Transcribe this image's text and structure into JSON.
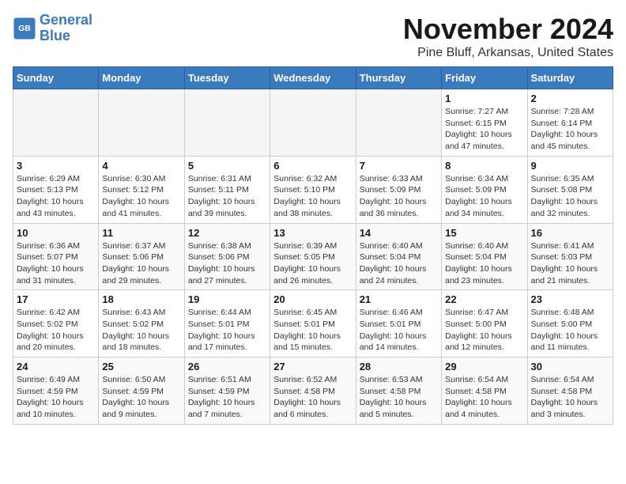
{
  "header": {
    "logo_line1": "General",
    "logo_line2": "Blue",
    "month": "November 2024",
    "location": "Pine Bluff, Arkansas, United States"
  },
  "days_of_week": [
    "Sunday",
    "Monday",
    "Tuesday",
    "Wednesday",
    "Thursday",
    "Friday",
    "Saturday"
  ],
  "weeks": [
    [
      {
        "day": "",
        "empty": true
      },
      {
        "day": "",
        "empty": true
      },
      {
        "day": "",
        "empty": true
      },
      {
        "day": "",
        "empty": true
      },
      {
        "day": "",
        "empty": true
      },
      {
        "day": "1",
        "info": "Sunrise: 7:27 AM\nSunset: 6:15 PM\nDaylight: 10 hours\nand 47 minutes."
      },
      {
        "day": "2",
        "info": "Sunrise: 7:28 AM\nSunset: 6:14 PM\nDaylight: 10 hours\nand 45 minutes."
      }
    ],
    [
      {
        "day": "3",
        "info": "Sunrise: 6:29 AM\nSunset: 5:13 PM\nDaylight: 10 hours\nand 43 minutes."
      },
      {
        "day": "4",
        "info": "Sunrise: 6:30 AM\nSunset: 5:12 PM\nDaylight: 10 hours\nand 41 minutes."
      },
      {
        "day": "5",
        "info": "Sunrise: 6:31 AM\nSunset: 5:11 PM\nDaylight: 10 hours\nand 39 minutes."
      },
      {
        "day": "6",
        "info": "Sunrise: 6:32 AM\nSunset: 5:10 PM\nDaylight: 10 hours\nand 38 minutes."
      },
      {
        "day": "7",
        "info": "Sunrise: 6:33 AM\nSunset: 5:09 PM\nDaylight: 10 hours\nand 36 minutes."
      },
      {
        "day": "8",
        "info": "Sunrise: 6:34 AM\nSunset: 5:09 PM\nDaylight: 10 hours\nand 34 minutes."
      },
      {
        "day": "9",
        "info": "Sunrise: 6:35 AM\nSunset: 5:08 PM\nDaylight: 10 hours\nand 32 minutes."
      }
    ],
    [
      {
        "day": "10",
        "info": "Sunrise: 6:36 AM\nSunset: 5:07 PM\nDaylight: 10 hours\nand 31 minutes."
      },
      {
        "day": "11",
        "info": "Sunrise: 6:37 AM\nSunset: 5:06 PM\nDaylight: 10 hours\nand 29 minutes."
      },
      {
        "day": "12",
        "info": "Sunrise: 6:38 AM\nSunset: 5:06 PM\nDaylight: 10 hours\nand 27 minutes."
      },
      {
        "day": "13",
        "info": "Sunrise: 6:39 AM\nSunset: 5:05 PM\nDaylight: 10 hours\nand 26 minutes."
      },
      {
        "day": "14",
        "info": "Sunrise: 6:40 AM\nSunset: 5:04 PM\nDaylight: 10 hours\nand 24 minutes."
      },
      {
        "day": "15",
        "info": "Sunrise: 6:40 AM\nSunset: 5:04 PM\nDaylight: 10 hours\nand 23 minutes."
      },
      {
        "day": "16",
        "info": "Sunrise: 6:41 AM\nSunset: 5:03 PM\nDaylight: 10 hours\nand 21 minutes."
      }
    ],
    [
      {
        "day": "17",
        "info": "Sunrise: 6:42 AM\nSunset: 5:02 PM\nDaylight: 10 hours\nand 20 minutes."
      },
      {
        "day": "18",
        "info": "Sunrise: 6:43 AM\nSunset: 5:02 PM\nDaylight: 10 hours\nand 18 minutes."
      },
      {
        "day": "19",
        "info": "Sunrise: 6:44 AM\nSunset: 5:01 PM\nDaylight: 10 hours\nand 17 minutes."
      },
      {
        "day": "20",
        "info": "Sunrise: 6:45 AM\nSunset: 5:01 PM\nDaylight: 10 hours\nand 15 minutes."
      },
      {
        "day": "21",
        "info": "Sunrise: 6:46 AM\nSunset: 5:01 PM\nDaylight: 10 hours\nand 14 minutes."
      },
      {
        "day": "22",
        "info": "Sunrise: 6:47 AM\nSunset: 5:00 PM\nDaylight: 10 hours\nand 12 minutes."
      },
      {
        "day": "23",
        "info": "Sunrise: 6:48 AM\nSunset: 5:00 PM\nDaylight: 10 hours\nand 11 minutes."
      }
    ],
    [
      {
        "day": "24",
        "info": "Sunrise: 6:49 AM\nSunset: 4:59 PM\nDaylight: 10 hours\nand 10 minutes."
      },
      {
        "day": "25",
        "info": "Sunrise: 6:50 AM\nSunset: 4:59 PM\nDaylight: 10 hours\nand 9 minutes."
      },
      {
        "day": "26",
        "info": "Sunrise: 6:51 AM\nSunset: 4:59 PM\nDaylight: 10 hours\nand 7 minutes."
      },
      {
        "day": "27",
        "info": "Sunrise: 6:52 AM\nSunset: 4:58 PM\nDaylight: 10 hours\nand 6 minutes."
      },
      {
        "day": "28",
        "info": "Sunrise: 6:53 AM\nSunset: 4:58 PM\nDaylight: 10 hours\nand 5 minutes."
      },
      {
        "day": "29",
        "info": "Sunrise: 6:54 AM\nSunset: 4:58 PM\nDaylight: 10 hours\nand 4 minutes."
      },
      {
        "day": "30",
        "info": "Sunrise: 6:54 AM\nSunset: 4:58 PM\nDaylight: 10 hours\nand 3 minutes."
      }
    ]
  ]
}
